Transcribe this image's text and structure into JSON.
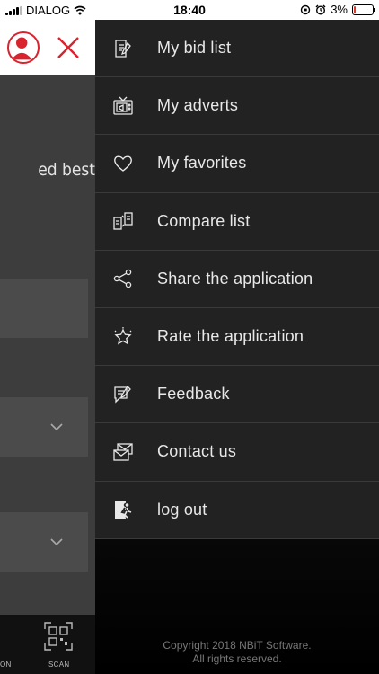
{
  "status_bar": {
    "carrier": "DIALOG",
    "time": "18:40",
    "battery": "3%",
    "battery_level": 0.03
  },
  "background_screen": {
    "partial_text": "ed best",
    "tab_partial_label": "ON",
    "tab_scan_label": "SCAN"
  },
  "menu": {
    "items": [
      {
        "label": "My bid list",
        "icon": "bid-list-icon"
      },
      {
        "label": "My adverts",
        "icon": "tv-advert-icon"
      },
      {
        "label": "My favorites",
        "icon": "heart-icon"
      },
      {
        "label": "Compare list",
        "icon": "compare-icon"
      },
      {
        "label": "Share the application",
        "icon": "share-icon"
      },
      {
        "label": "Rate the application",
        "icon": "star-icon"
      },
      {
        "label": "Feedback",
        "icon": "feedback-icon"
      },
      {
        "label": "Contact us",
        "icon": "envelope-icon"
      },
      {
        "label": "log out",
        "icon": "logout-icon"
      }
    ],
    "footer_line1": "Copyright 2018 NBiT Software.",
    "footer_line2": "All rights reserved."
  },
  "colors": {
    "brand_red": "#d9232e",
    "menu_bg": "#222222",
    "menu_text": "#e8e8e8"
  }
}
